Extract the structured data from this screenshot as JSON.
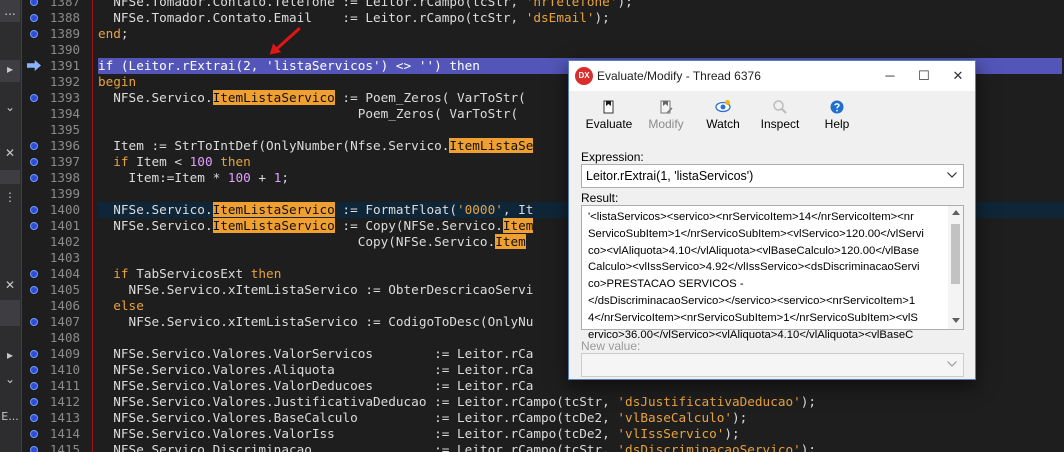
{
  "left_strip": {
    "items": [
      "...",
      "▸",
      "⌄",
      "✕",
      "⋮",
      "✕",
      "▸",
      "⌄",
      "E..."
    ]
  },
  "editor": {
    "lines": [
      {
        "no": "1387",
        "bp": true,
        "exec": false,
        "cls": "",
        "html": "  <span>NFSe.Tomador.Contato.Telefone := Leitor.rCampo(tcStr, <span class=\"str\">'nrTelefone'</span>);</span>"
      },
      {
        "no": "1388",
        "bp": true,
        "exec": false,
        "cls": "",
        "html": "  NFSe.Tomador.Contato.Email    := Leitor.rCampo(tcStr, <span class=\"str\">'dsEmail'</span>);"
      },
      {
        "no": "1389",
        "bp": true,
        "exec": false,
        "cls": "",
        "html": "<span class=\"kw\">end</span>;"
      },
      {
        "no": "1390",
        "bp": false,
        "exec": false,
        "cls": "",
        "html": ""
      },
      {
        "no": "1391",
        "bp": false,
        "exec": true,
        "cls": "current",
        "html": "<span class=\"cur-kw\">if</span> (Leitor.rExtrai(2, 'listaServicos') &lt;&gt; '') <span class=\"cur-kw\">then</span>"
      },
      {
        "no": "1392",
        "bp": false,
        "exec": false,
        "cls": "",
        "html": "<span class=\"kw\">begin</span>"
      },
      {
        "no": "1393",
        "bp": true,
        "exec": false,
        "cls": "",
        "html": "  NFSe.Servico.<span class=\"hlw\">ItemListaServico</span> := Poem_Zeros( VarToStr("
      },
      {
        "no": "1394",
        "bp": false,
        "exec": false,
        "cls": "",
        "html": "                                  Poem_Zeros( VarToStr("
      },
      {
        "no": "1395",
        "bp": false,
        "exec": false,
        "cls": "",
        "html": ""
      },
      {
        "no": "1396",
        "bp": true,
        "exec": false,
        "cls": "",
        "html": "  Item := StrToIntDef(OnlyNumber(Nfse.Servico.<span class=\"hlw\">ItemListaSe</span>"
      },
      {
        "no": "1397",
        "bp": true,
        "exec": false,
        "cls": "",
        "html": "  <span class=\"kw\">if</span> Item &lt; <span class=\"num\">100</span> <span class=\"kw\">then</span>"
      },
      {
        "no": "1398",
        "bp": true,
        "exec": false,
        "cls": "",
        "html": "    Item:=Item * <span class=\"num\">100</span> + <span class=\"num\">1</span>;"
      },
      {
        "no": "1399",
        "bp": false,
        "exec": false,
        "cls": "",
        "html": ""
      },
      {
        "no": "1400",
        "bp": true,
        "exec": false,
        "cls": "hl",
        "html": "  NFSe.Servico.<span class=\"hlw\">ItemListaServico</span> := FormatFloat(<span class=\"str\">'0000'</span>, It"
      },
      {
        "no": "1401",
        "bp": true,
        "exec": false,
        "cls": "",
        "html": "  NFSe.Servico.<span class=\"hlw\">ItemListaServico</span> := Copy(NFSe.Servico.<span class=\"hlw\">Item</span>"
      },
      {
        "no": "1402",
        "bp": false,
        "exec": false,
        "cls": "",
        "html": "                                  Copy(NFSe.Servico.<span class=\"hlw\">Item</span>"
      },
      {
        "no": "1403",
        "bp": false,
        "exec": false,
        "cls": "",
        "html": ""
      },
      {
        "no": "1404",
        "bp": true,
        "exec": false,
        "cls": "",
        "html": "  <span class=\"kw\">if</span> TabServicosExt <span class=\"kw\">then</span>"
      },
      {
        "no": "1405",
        "bp": true,
        "exec": false,
        "cls": "",
        "html": "    NFSe.Servico.xItemListaServico := ObterDescricaoServi"
      },
      {
        "no": "1406",
        "bp": false,
        "exec": false,
        "cls": "",
        "html": "  <span class=\"kw\">else</span>"
      },
      {
        "no": "1407",
        "bp": true,
        "exec": false,
        "cls": "",
        "html": "    NFSe.Servico.xItemListaServico := CodigoToDesc(OnlyNu"
      },
      {
        "no": "1408",
        "bp": false,
        "exec": false,
        "cls": "",
        "html": ""
      },
      {
        "no": "1409",
        "bp": true,
        "exec": false,
        "cls": "",
        "html": "  NFSe.Servico.Valores.ValorServicos        := Leitor.rCa"
      },
      {
        "no": "1410",
        "bp": true,
        "exec": false,
        "cls": "",
        "html": "  NFSe.Servico.Valores.Aliquota             := Leitor.rCa"
      },
      {
        "no": "1411",
        "bp": true,
        "exec": false,
        "cls": "",
        "html": "  NFSe.Servico.Valores.ValorDeducoes        := Leitor.rCa"
      },
      {
        "no": "1412",
        "bp": true,
        "exec": false,
        "cls": "",
        "html": "  NFSe.Servico.Valores.JustificativaDeducao := Leitor.rCampo(tcStr, <span class=\"str\">'dsJustificativaDeducao'</span>);"
      },
      {
        "no": "1413",
        "bp": true,
        "exec": false,
        "cls": "",
        "html": "  NFSe.Servico.Valores.BaseCalculo          := Leitor.rCampo(tcDe2, <span class=\"str\">'vlBaseCalculo'</span>);"
      },
      {
        "no": "1414",
        "bp": true,
        "exec": false,
        "cls": "",
        "html": "  NFSe.Servico.Valores.ValorIss             := Leitor.rCampo(tcDe2, <span class=\"str\">'vlIssServico'</span>);"
      },
      {
        "no": "1415",
        "bp": true,
        "exec": false,
        "cls": "",
        "html": "  NFSe.Servico.Discriminacao                := Leitor.rCampo(tcStr, <span class=\"str\">'dsDiscriminacaoServico'</span>);"
      }
    ]
  },
  "dialog": {
    "title": "Evaluate/Modify - Thread 6376",
    "logo": "DX",
    "toolbar": {
      "evaluate": "Evaluate",
      "modify": "Modify",
      "watch": "Watch",
      "inspect": "Inspect",
      "help": "Help"
    },
    "expression_label": "Expression:",
    "expression_value": "Leitor.rExtrai(1, 'listaServicos')",
    "result_label": "Result:",
    "result_lines": [
      "'<listaServicos><servico><nrServicoItem>14</nrServicoItem><nr",
      "ServicoSubItem>1</nrServicoSubItem><vlServico>120.00</vlServi",
      "co><vlAliquota>4.10</vlAliquota><vlBaseCalculo>120.00</vlBase",
      "Calculo><vlIssServico>4.92</vlIssServico><dsDiscriminacaoServi",
      "co>PRESTACAO SERVICOS -",
      "</dsDiscriminacaoServico></servico><servico><nrServicoItem>1",
      "4</nrServicoItem><nrServicoSubItem>1</nrServicoSubItem><vlS",
      "ervico>36.00</vlServico><vlAliquota>4.10</vlAliquota><vlBaseC"
    ],
    "new_value_label": "New value:",
    "new_value": ""
  },
  "colors": {
    "current_line": "#5355b8",
    "keyword": "#e8a33d",
    "highlight": "#f0a030",
    "arrow": "#e01515"
  }
}
